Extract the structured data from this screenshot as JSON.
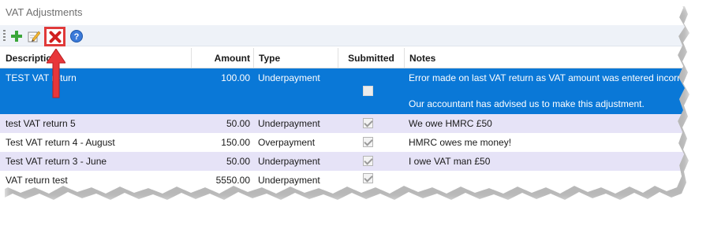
{
  "window": {
    "title": "VAT Adjustments"
  },
  "toolbar": {
    "add_icon": "plus-icon",
    "edit_icon": "edit-pencil-icon",
    "delete_icon": "red-x-delete-icon",
    "help_icon": "help-question-icon"
  },
  "columns": {
    "description": "Description",
    "amount": "Amount",
    "type": "Type",
    "submitted": "Submitted",
    "notes": "Notes"
  },
  "rows": [
    {
      "description": "TEST VAT return",
      "amount": "100.00",
      "type": "Underpayment",
      "submitted": false,
      "notes": "Error made on last VAT return as VAT amount was entered incorre",
      "notes_line2": "Our accountant has advised us to make this adjustment."
    },
    {
      "description": "test VAT return 5",
      "amount": "50.00",
      "type": "Underpayment",
      "submitted": true,
      "notes": "We owe HMRC £50"
    },
    {
      "description": "Test VAT return 4 - August",
      "amount": "150.00",
      "type": "Overpayment",
      "submitted": true,
      "notes": "HMRC owes me money!"
    },
    {
      "description": "Test VAT return 3 - June",
      "amount": "50.00",
      "type": "Underpayment",
      "submitted": true,
      "notes": "I owe VAT man £50"
    },
    {
      "description": "VAT return test",
      "amount": "5550.00",
      "type": "Underpayment",
      "submitted": true,
      "notes": ""
    }
  ],
  "colors": {
    "selected_row": "#0a78d7",
    "alt_row": "#e6e3f7",
    "highlight_border": "#e03a3a",
    "arrow": "#e8363a"
  }
}
